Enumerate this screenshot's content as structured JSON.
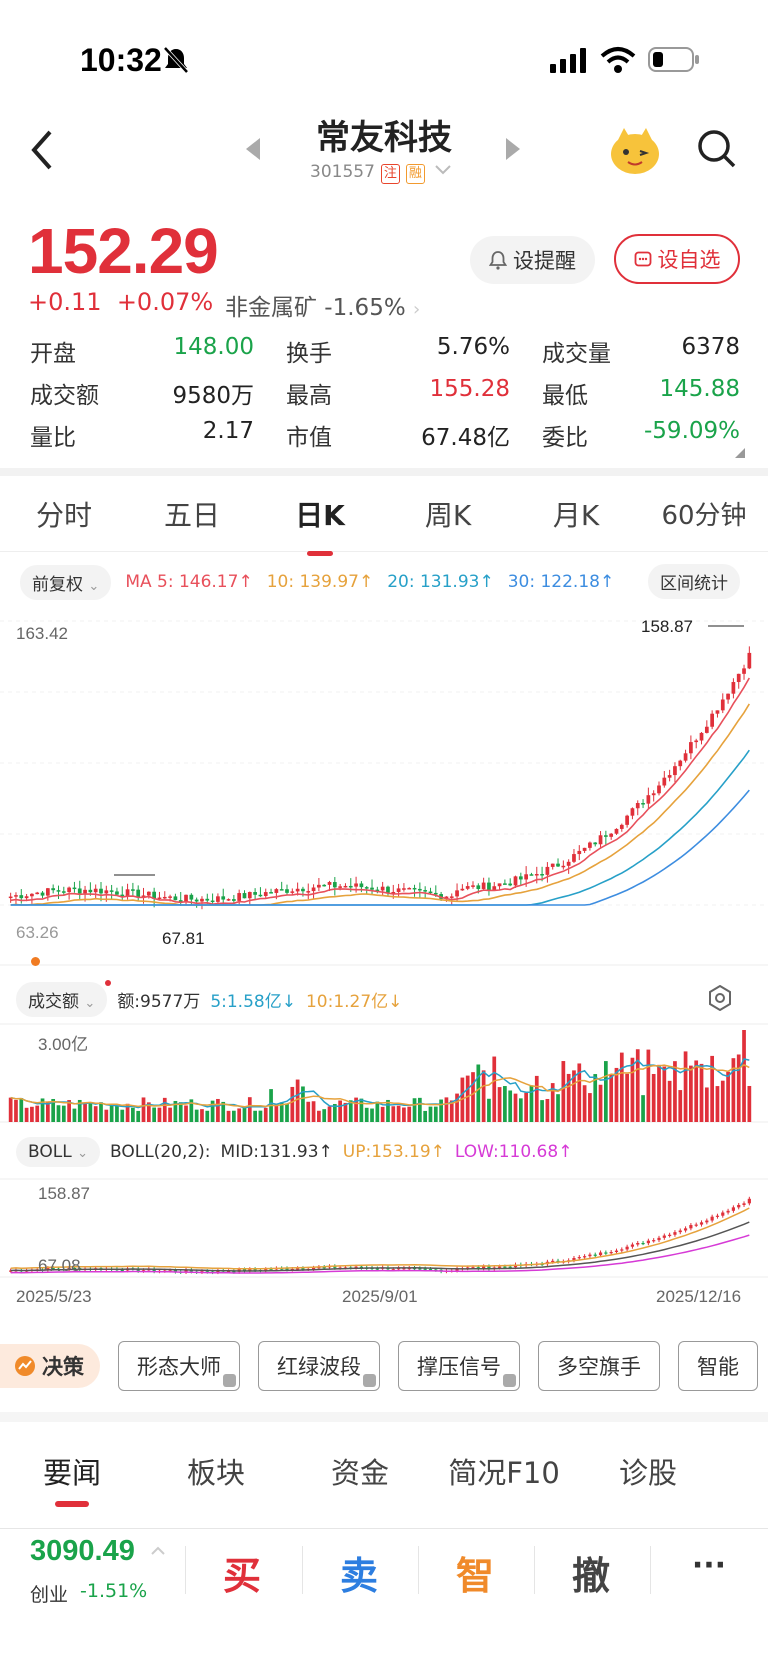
{
  "status": {
    "time": "10:32"
  },
  "nav": {
    "title": "常友科技",
    "code": "301557",
    "tag1": "注",
    "tag2": "融"
  },
  "quote": {
    "price": "152.29",
    "change": "+0.11",
    "change_pct": "+0.07%",
    "sector": "非金属矿 -1.65%",
    "remind_label": "设提醒",
    "fav_label": "设自选"
  },
  "stats": [
    [
      {
        "label": "开盘",
        "value": "148.00",
        "color": "down"
      },
      {
        "label": "换手",
        "value": "5.76%",
        "color": ""
      },
      {
        "label": "成交量",
        "value": "6378",
        "color": ""
      }
    ],
    [
      {
        "label": "成交额",
        "value": "9580万",
        "color": ""
      },
      {
        "label": "最高",
        "value": "155.28",
        "color": "up"
      },
      {
        "label": "最低",
        "value": "145.88",
        "color": "down"
      }
    ],
    [
      {
        "label": "量比",
        "value": "2.17",
        "color": ""
      },
      {
        "label": "市值",
        "value": "67.48亿",
        "color": ""
      },
      {
        "label": "委比",
        "value": "-59.09%",
        "color": "down"
      }
    ]
  ],
  "periods": [
    "分时",
    "五日",
    "日K",
    "周K",
    "月K",
    "60分钟"
  ],
  "ma": {
    "adjust": "前复权",
    "ma5": "MA 5: 146.17↑",
    "ma10": "10: 139.97↑",
    "ma20": "20: 131.93↑",
    "ma30": "30: 122.18↑",
    "range_stats": "区间统计",
    "colors": {
      "ma5": "#e8505b",
      "ma10": "#e6a23c",
      "ma20": "#27a0c8",
      "ma30": "#3d8de0"
    }
  },
  "kline": {
    "y_top_label": "163.42",
    "y_bottom_label": "63.26",
    "high_label": "158.87",
    "low_label": "67.81"
  },
  "volume": {
    "selector": "成交额",
    "amount": "额:9577万",
    "ma5": "5:1.58亿↓",
    "ma10": "10:1.27亿↓",
    "y_top": "3.00亿",
    "y_low": "0"
  },
  "boll": {
    "selector": "BOLL",
    "params": "BOLL(20,2):",
    "mid": "MID:131.93↑",
    "up": "UP:153.19↑",
    "low": "LOW:110.68↑",
    "y_top": "158.87",
    "y_bottom": "67.08"
  },
  "dates": {
    "start": "2025/5/23",
    "mid": "2025/9/01",
    "end": "2025/12/16"
  },
  "tools": {
    "decision": "决策",
    "items": [
      "形态大师",
      "红绿波段",
      "撑压信号",
      "多空旗手",
      "智能"
    ]
  },
  "news_tabs": [
    "要闻",
    "板块",
    "资金",
    "简况F10",
    "诊股"
  ],
  "bottom": {
    "index_value": "3090.49",
    "index_name": "创业",
    "index_change": "-1.51%",
    "buy": "买",
    "sell": "卖",
    "smart": "智",
    "cancel": "撤",
    "more": "···"
  }
}
